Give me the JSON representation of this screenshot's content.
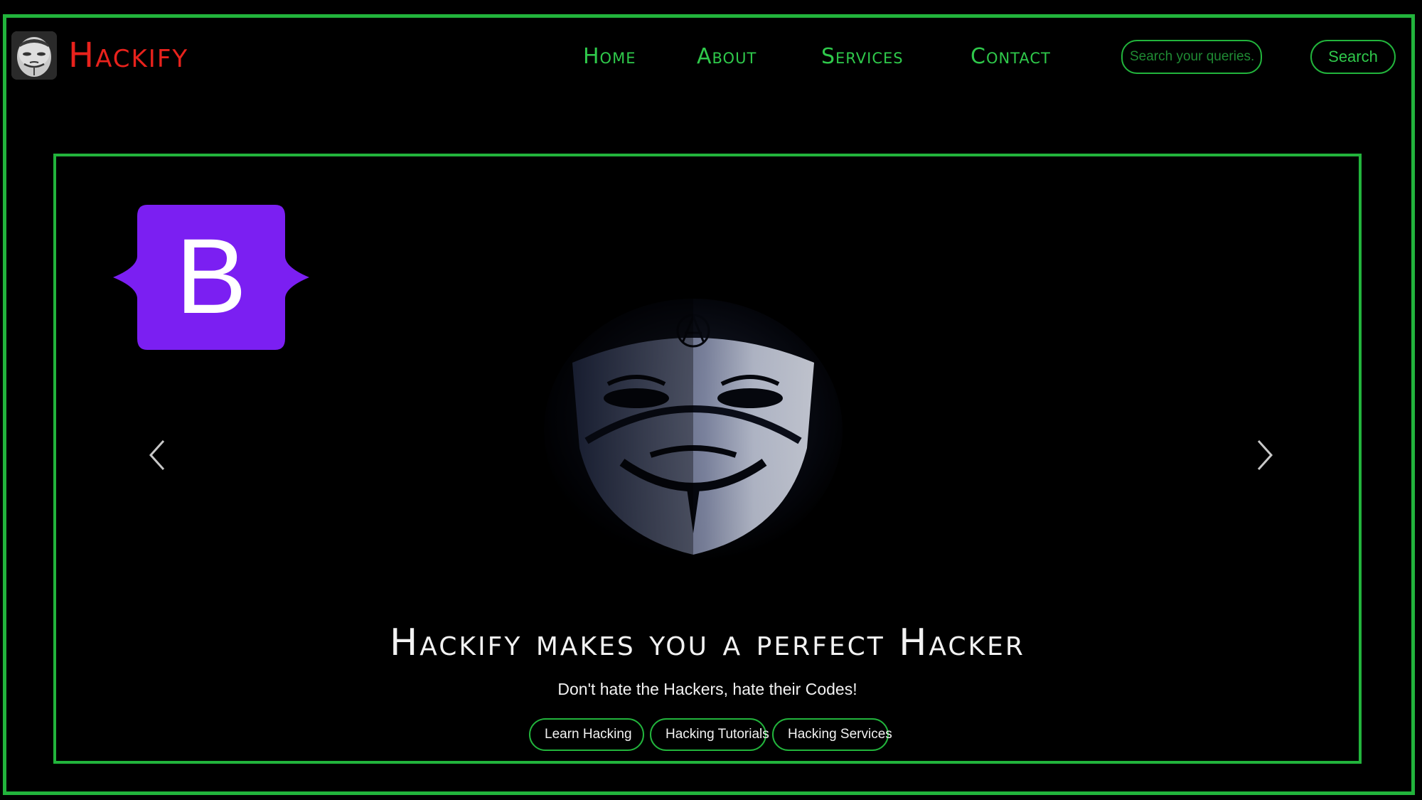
{
  "brand": {
    "name": "Hackify",
    "logo_icon": "anonymous-mask-logo"
  },
  "nav": {
    "items": [
      {
        "label": "Home"
      },
      {
        "label": "About"
      },
      {
        "label": "Services"
      },
      {
        "label": "Contact"
      }
    ]
  },
  "search": {
    "placeholder": "Search your queries.....",
    "button_label": "Search"
  },
  "carousel": {
    "badge_letter": "B",
    "badge_icon": "bootstrap-logo",
    "image_icon": "guy-fawkes-mask",
    "prev_icon": "chevron-left-icon",
    "next_icon": "chevron-right-icon",
    "title": "Hackify makes you a perfect Hacker",
    "subtitle": "Don't hate the Hackers, hate their Codes!",
    "buttons": [
      {
        "label": "Learn Hacking"
      },
      {
        "label": "Hacking Tutorials"
      },
      {
        "label": "Hacking Services"
      }
    ]
  },
  "colors": {
    "accent_green": "#22b43c",
    "brand_red": "#e8221c",
    "bootstrap_purple": "#7b1ff2",
    "background": "#000000"
  }
}
